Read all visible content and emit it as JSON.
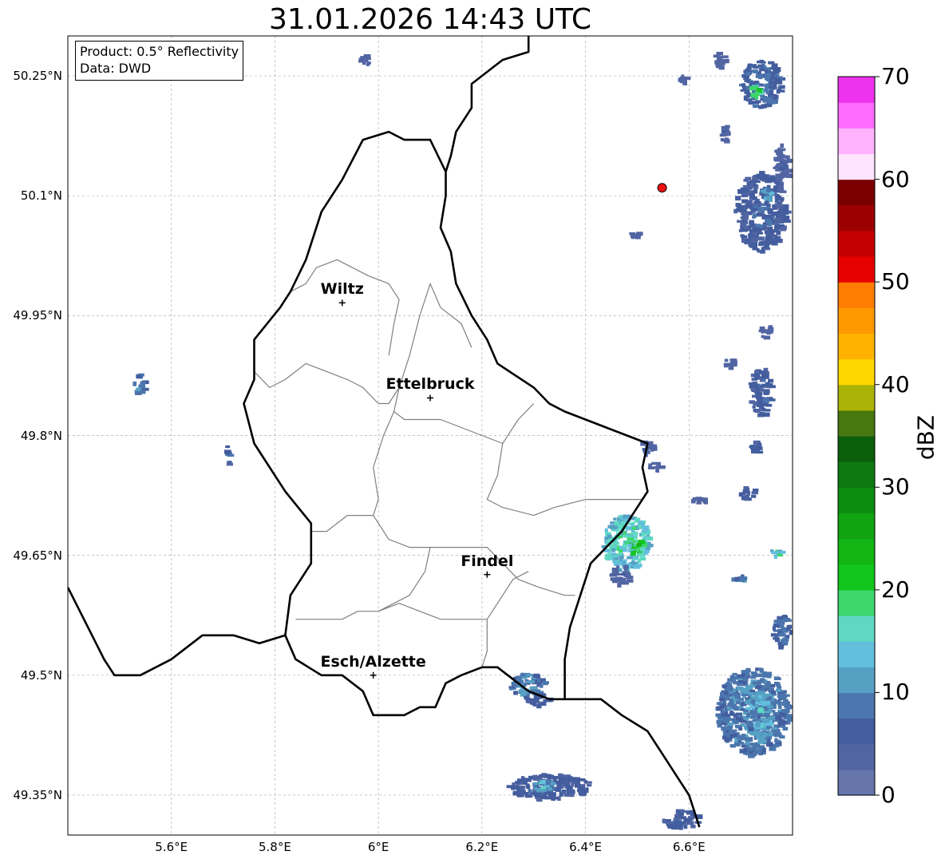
{
  "title": "31.01.2026 14:43 UTC",
  "info_box": {
    "line1": "Product: 0.5° Reflectivity",
    "line2": "Data: DWD"
  },
  "map": {
    "lon_range": [
      5.4,
      6.8
    ],
    "lat_range": [
      49.3,
      50.3
    ],
    "lat_ticks": [
      {
        "value": 50.25,
        "label": "50.25°N"
      },
      {
        "value": 50.1,
        "label": "50.1°N"
      },
      {
        "value": 49.95,
        "label": "49.95°N"
      },
      {
        "value": 49.8,
        "label": "49.8°N"
      },
      {
        "value": 49.65,
        "label": "49.65°N"
      },
      {
        "value": 49.5,
        "label": "49.5°N"
      },
      {
        "value": 49.35,
        "label": "49.35°N"
      }
    ],
    "lon_ticks": [
      {
        "value": 5.6,
        "label": "5.6°E"
      },
      {
        "value": 5.8,
        "label": "5.8°E"
      },
      {
        "value": 6.0,
        "label": "6°E"
      },
      {
        "value": 6.2,
        "label": "6.2°E"
      },
      {
        "value": 6.4,
        "label": "6.4°E"
      },
      {
        "value": 6.6,
        "label": "6.6°E"
      }
    ],
    "gridlines": true,
    "cities": [
      {
        "name": "Wiltz",
        "lon": 5.93,
        "lat": 49.966
      },
      {
        "name": "Ettelbruck",
        "lon": 6.1,
        "lat": 49.847
      },
      {
        "name": "Findel",
        "lon": 6.21,
        "lat": 49.626
      },
      {
        "name": "Esch/Alzette",
        "lon": 5.99,
        "lat": 49.5
      }
    ],
    "radar_site": {
      "lon": 6.548,
      "lat": 50.11,
      "color": "#ee1111"
    },
    "country_border_color": "#000000",
    "canton_border_color": "#808080",
    "country_border_points": [
      [
        6.29,
        50.3
      ],
      [
        6.29,
        50.28
      ],
      [
        6.24,
        50.27
      ],
      [
        6.22,
        50.26
      ],
      [
        6.18,
        50.24
      ],
      [
        6.18,
        50.21
      ],
      [
        6.15,
        50.18
      ],
      [
        6.14,
        50.15
      ],
      [
        6.13,
        50.13
      ],
      [
        6.13,
        50.1
      ],
      [
        6.12,
        50.06
      ],
      [
        6.14,
        50.03
      ],
      [
        6.15,
        49.99
      ],
      [
        6.18,
        49.95
      ],
      [
        6.21,
        49.92
      ],
      [
        6.23,
        49.89
      ],
      [
        6.3,
        49.86
      ],
      [
        6.33,
        49.84
      ],
      [
        6.36,
        49.83
      ],
      [
        6.4,
        49.82
      ],
      [
        6.44,
        49.81
      ],
      [
        6.48,
        49.8
      ],
      [
        6.52,
        49.79
      ],
      [
        6.51,
        49.76
      ],
      [
        6.52,
        49.73
      ],
      [
        6.5,
        49.71
      ],
      [
        6.47,
        49.68
      ],
      [
        6.44,
        49.66
      ],
      [
        6.41,
        49.64
      ],
      [
        6.39,
        49.6
      ],
      [
        6.37,
        49.56
      ],
      [
        6.36,
        49.52
      ],
      [
        6.36,
        49.47
      ],
      [
        6.33,
        49.47
      ],
      [
        6.29,
        49.48
      ],
      [
        6.23,
        49.51
      ],
      [
        6.2,
        49.51
      ],
      [
        6.16,
        49.5
      ],
      [
        6.13,
        49.49
      ],
      [
        6.11,
        49.46
      ],
      [
        6.08,
        49.46
      ],
      [
        6.05,
        49.45
      ],
      [
        5.99,
        49.45
      ],
      [
        5.97,
        49.48
      ],
      [
        5.93,
        49.5
      ],
      [
        5.89,
        49.5
      ],
      [
        5.84,
        49.52
      ],
      [
        5.82,
        49.55
      ],
      [
        5.83,
        49.6
      ],
      [
        5.87,
        49.64
      ],
      [
        5.87,
        49.69
      ],
      [
        5.82,
        49.73
      ],
      [
        5.76,
        49.79
      ],
      [
        5.74,
        49.84
      ],
      [
        5.76,
        49.87
      ],
      [
        5.76,
        49.92
      ],
      [
        5.81,
        49.96
      ],
      [
        5.83,
        49.98
      ],
      [
        5.86,
        50.02
      ],
      [
        5.89,
        50.08
      ],
      [
        5.93,
        50.12
      ],
      [
        5.97,
        50.17
      ],
      [
        6.02,
        50.18
      ],
      [
        6.05,
        50.17
      ],
      [
        6.1,
        50.17
      ],
      [
        6.13,
        50.13
      ]
    ],
    "border_west_points": [
      [
        5.4,
        49.61
      ],
      [
        5.47,
        49.52
      ],
      [
        5.49,
        49.5
      ],
      [
        5.54,
        49.5
      ],
      [
        5.6,
        49.52
      ],
      [
        5.66,
        49.55
      ],
      [
        5.72,
        49.55
      ],
      [
        5.77,
        49.54
      ],
      [
        5.82,
        49.55
      ]
    ],
    "border_south_points": [
      [
        6.36,
        49.47
      ],
      [
        6.43,
        49.47
      ],
      [
        6.47,
        49.45
      ],
      [
        6.52,
        49.43
      ],
      [
        6.55,
        49.4
      ],
      [
        6.58,
        49.37
      ],
      [
        6.6,
        49.35
      ],
      [
        6.62,
        49.31
      ]
    ],
    "canton_lines": [
      [
        [
          5.83,
          49.98
        ],
        [
          5.86,
          49.99
        ],
        [
          5.88,
          50.01
        ],
        [
          5.92,
          50.02
        ],
        [
          5.95,
          50.01
        ],
        [
          5.98,
          50.0
        ],
        [
          6.02,
          49.99
        ],
        [
          6.04,
          49.97
        ],
        [
          6.03,
          49.94
        ],
        [
          6.02,
          49.9
        ]
      ],
      [
        [
          5.76,
          49.88
        ],
        [
          5.79,
          49.86
        ],
        [
          5.82,
          49.87
        ],
        [
          5.86,
          49.89
        ],
        [
          5.9,
          49.88
        ],
        [
          5.94,
          49.87
        ],
        [
          5.97,
          49.86
        ],
        [
          6.0,
          49.84
        ],
        [
          6.02,
          49.84
        ],
        [
          6.04,
          49.86
        ],
        [
          6.05,
          49.88
        ]
      ],
      [
        [
          6.05,
          49.88
        ],
        [
          6.06,
          49.9
        ],
        [
          6.08,
          49.95
        ],
        [
          6.1,
          49.99
        ],
        [
          6.12,
          49.96
        ],
        [
          6.16,
          49.94
        ],
        [
          6.18,
          49.91
        ]
      ],
      [
        [
          6.04,
          49.86
        ],
        [
          6.03,
          49.83
        ],
        [
          6.05,
          49.82
        ],
        [
          6.08,
          49.82
        ],
        [
          6.12,
          49.82
        ],
        [
          6.16,
          49.81
        ],
        [
          6.2,
          49.8
        ],
        [
          6.24,
          49.79
        ],
        [
          6.27,
          49.82
        ],
        [
          6.3,
          49.84
        ]
      ],
      [
        [
          6.03,
          49.83
        ],
        [
          6.01,
          49.8
        ],
        [
          5.99,
          49.76
        ],
        [
          6.0,
          49.72
        ],
        [
          5.99,
          49.7
        ],
        [
          5.94,
          49.7
        ],
        [
          5.9,
          49.68
        ],
        [
          5.87,
          49.68
        ]
      ],
      [
        [
          6.24,
          49.79
        ],
        [
          6.23,
          49.75
        ],
        [
          6.21,
          49.72
        ],
        [
          6.24,
          49.71
        ],
        [
          6.3,
          49.7
        ],
        [
          6.34,
          49.71
        ],
        [
          6.4,
          49.72
        ],
        [
          6.46,
          49.72
        ],
        [
          6.51,
          49.72
        ]
      ],
      [
        [
          5.99,
          49.7
        ],
        [
          6.02,
          49.67
        ],
        [
          6.06,
          49.66
        ],
        [
          6.1,
          49.66
        ],
        [
          6.16,
          49.66
        ],
        [
          6.21,
          49.66
        ],
        [
          6.24,
          49.64
        ],
        [
          6.27,
          49.62
        ],
        [
          6.31,
          49.61
        ],
        [
          6.36,
          49.6
        ],
        [
          6.38,
          49.6
        ]
      ],
      [
        [
          6.1,
          49.66
        ],
        [
          6.09,
          49.63
        ],
        [
          6.06,
          49.6
        ],
        [
          6.03,
          49.59
        ],
        [
          6.0,
          49.58
        ]
      ],
      [
        [
          5.84,
          49.57
        ],
        [
          5.88,
          49.57
        ],
        [
          5.93,
          49.57
        ],
        [
          5.96,
          49.58
        ],
        [
          6.0,
          49.58
        ],
        [
          6.04,
          49.59
        ],
        [
          6.08,
          49.58
        ],
        [
          6.12,
          49.57
        ],
        [
          6.17,
          49.57
        ],
        [
          6.21,
          49.57
        ]
      ],
      [
        [
          6.21,
          49.57
        ],
        [
          6.21,
          49.53
        ],
        [
          6.2,
          49.51
        ]
      ],
      [
        [
          6.21,
          49.57
        ],
        [
          6.24,
          49.6
        ],
        [
          6.26,
          49.62
        ],
        [
          6.29,
          49.63
        ]
      ]
    ],
    "echoes": [
      {
        "lon": 6.48,
        "lat": 49.665,
        "rlon": 0.045,
        "rlat": 0.035,
        "dbz": 20
      },
      {
        "lon": 6.5,
        "lat": 49.66,
        "rlon": 0.015,
        "rlat": 0.012,
        "dbz": 25
      },
      {
        "lon": 6.47,
        "lat": 49.625,
        "rlon": 0.02,
        "rlat": 0.012,
        "dbz": 5
      },
      {
        "lon": 6.52,
        "lat": 49.785,
        "rlon": 0.012,
        "rlat": 0.01,
        "dbz": 7
      },
      {
        "lon": 6.535,
        "lat": 49.76,
        "rlon": 0.012,
        "rlat": 0.006,
        "dbz": 5
      },
      {
        "lon": 6.29,
        "lat": 49.487,
        "rlon": 0.035,
        "rlat": 0.015,
        "dbz": 12
      },
      {
        "lon": 6.31,
        "lat": 49.47,
        "rlon": 0.025,
        "rlat": 0.008,
        "dbz": 8
      },
      {
        "lon": 6.33,
        "lat": 49.36,
        "rlon": 0.08,
        "rlat": 0.016,
        "dbz": 8
      },
      {
        "lon": 6.32,
        "lat": 49.362,
        "rlon": 0.02,
        "rlat": 0.008,
        "dbz": 16
      },
      {
        "lon": 6.585,
        "lat": 49.32,
        "rlon": 0.035,
        "rlat": 0.012,
        "dbz": 8
      },
      {
        "lon": 6.725,
        "lat": 49.455,
        "rlon": 0.07,
        "rlat": 0.055,
        "dbz": 12
      },
      {
        "lon": 6.74,
        "lat": 49.45,
        "rlon": 0.02,
        "rlat": 0.03,
        "dbz": 16
      },
      {
        "lon": 6.78,
        "lat": 49.555,
        "rlon": 0.018,
        "rlat": 0.02,
        "dbz": 10
      },
      {
        "lon": 6.74,
        "lat": 50.08,
        "rlon": 0.05,
        "rlat": 0.05,
        "dbz": 8
      },
      {
        "lon": 6.75,
        "lat": 50.1,
        "rlon": 0.012,
        "rlat": 0.008,
        "dbz": 16
      },
      {
        "lon": 6.74,
        "lat": 50.24,
        "rlon": 0.04,
        "rlat": 0.03,
        "dbz": 10
      },
      {
        "lon": 6.73,
        "lat": 50.23,
        "rlon": 0.012,
        "rlat": 0.008,
        "dbz": 25
      },
      {
        "lon": 6.78,
        "lat": 50.14,
        "rlon": 0.015,
        "rlat": 0.025,
        "dbz": 5
      },
      {
        "lon": 6.67,
        "lat": 50.18,
        "rlon": 0.008,
        "rlat": 0.012,
        "dbz": 5
      },
      {
        "lon": 6.66,
        "lat": 50.27,
        "rlon": 0.01,
        "rlat": 0.01,
        "dbz": 5
      },
      {
        "lon": 6.74,
        "lat": 49.855,
        "rlon": 0.022,
        "rlat": 0.03,
        "dbz": 8
      },
      {
        "lon": 6.75,
        "lat": 49.93,
        "rlon": 0.012,
        "rlat": 0.008,
        "dbz": 5
      },
      {
        "lon": 6.715,
        "lat": 49.728,
        "rlon": 0.015,
        "rlat": 0.008,
        "dbz": 8
      },
      {
        "lon": 6.73,
        "lat": 49.785,
        "rlon": 0.012,
        "rlat": 0.008,
        "dbz": 8
      },
      {
        "lon": 5.54,
        "lat": 49.864,
        "rlon": 0.01,
        "rlat": 0.012,
        "dbz": 12
      },
      {
        "lon": 5.71,
        "lat": 49.774,
        "rlon": 0.006,
        "rlat": 0.012,
        "dbz": 8
      },
      {
        "lon": 6.62,
        "lat": 49.718,
        "rlon": 0.015,
        "rlat": 0.005,
        "dbz": 5
      },
      {
        "lon": 6.68,
        "lat": 49.89,
        "rlon": 0.012,
        "rlat": 0.005,
        "dbz": 5
      },
      {
        "lon": 6.59,
        "lat": 50.245,
        "rlon": 0.008,
        "rlat": 0.005,
        "dbz": 5
      },
      {
        "lon": 6.5,
        "lat": 50.05,
        "rlon": 0.015,
        "rlat": 0.005,
        "dbz": 5
      },
      {
        "lon": 5.975,
        "lat": 50.27,
        "rlon": 0.01,
        "rlat": 0.008,
        "dbz": 5
      },
      {
        "lon": 6.7,
        "lat": 49.62,
        "rlon": 0.015,
        "rlat": 0.005,
        "dbz": 12
      },
      {
        "lon": 6.77,
        "lat": 49.653,
        "rlon": 0.01,
        "rlat": 0.005,
        "dbz": 20
      }
    ]
  },
  "colorbar": {
    "label": "dBZ",
    "min": 0,
    "max": 70,
    "ticks": [
      "0",
      "10",
      "20",
      "30",
      "40",
      "50",
      "60",
      "70"
    ],
    "colors": [
      "#6675ab",
      "#5265a3",
      "#435d9e",
      "#4b76ad",
      "#56a0c4",
      "#62bfdd",
      "#5fd8c3",
      "#3dd66d",
      "#11c61d",
      "#12b514",
      "#11a312",
      "#0e8c12",
      "#0c7a10",
      "#0b5e0b",
      "#487810",
      "#aab306",
      "#ffd700",
      "#ffb300",
      "#ff9900",
      "#ff7d00",
      "#e60000",
      "#c40000",
      "#9d0000",
      "#7a0000",
      "#ffe3ff",
      "#ffb3ff",
      "#ff6bff",
      "#ed33ed"
    ]
  }
}
